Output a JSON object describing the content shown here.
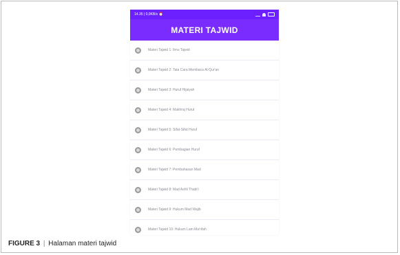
{
  "figure": {
    "label": "FIGURE 3",
    "separator": "|",
    "caption": "Halaman materi tajwid"
  },
  "statusbar": {
    "left": "14.35 | 0,0KB/s ⏰",
    "icons": [
      "signal-icon",
      "wifi-icon",
      "battery-icon"
    ]
  },
  "appbar": {
    "title": "MATERI TAJWID",
    "color": "#7a2cff"
  },
  "list": [
    {
      "label": "Materi Tajwid 1: Ilmu Tajwid"
    },
    {
      "label": "Materi Tajwid 2: Tata Cara Membaca Al-Qur'an"
    },
    {
      "label": "Materi Tajwid 3: Huruf Hijaiyah"
    },
    {
      "label": "Materi Tajwid 4: Makhraj Huruf"
    },
    {
      "label": "Materi Tajwid 5: Sifat-Sifat Huruf"
    },
    {
      "label": "Materi Tajwid 6: Pembagian Huruf"
    },
    {
      "label": "Materi Tajwid 7: Pembahasan Mad"
    },
    {
      "label": "Materi Tajwid 8: Mad Ashli Thabi'i"
    },
    {
      "label": "Materi Tajwid 9: Hukum Mad Wajib"
    },
    {
      "label": "Materi Tajwid 10: Hukum Lam Ma'rifah"
    }
  ]
}
